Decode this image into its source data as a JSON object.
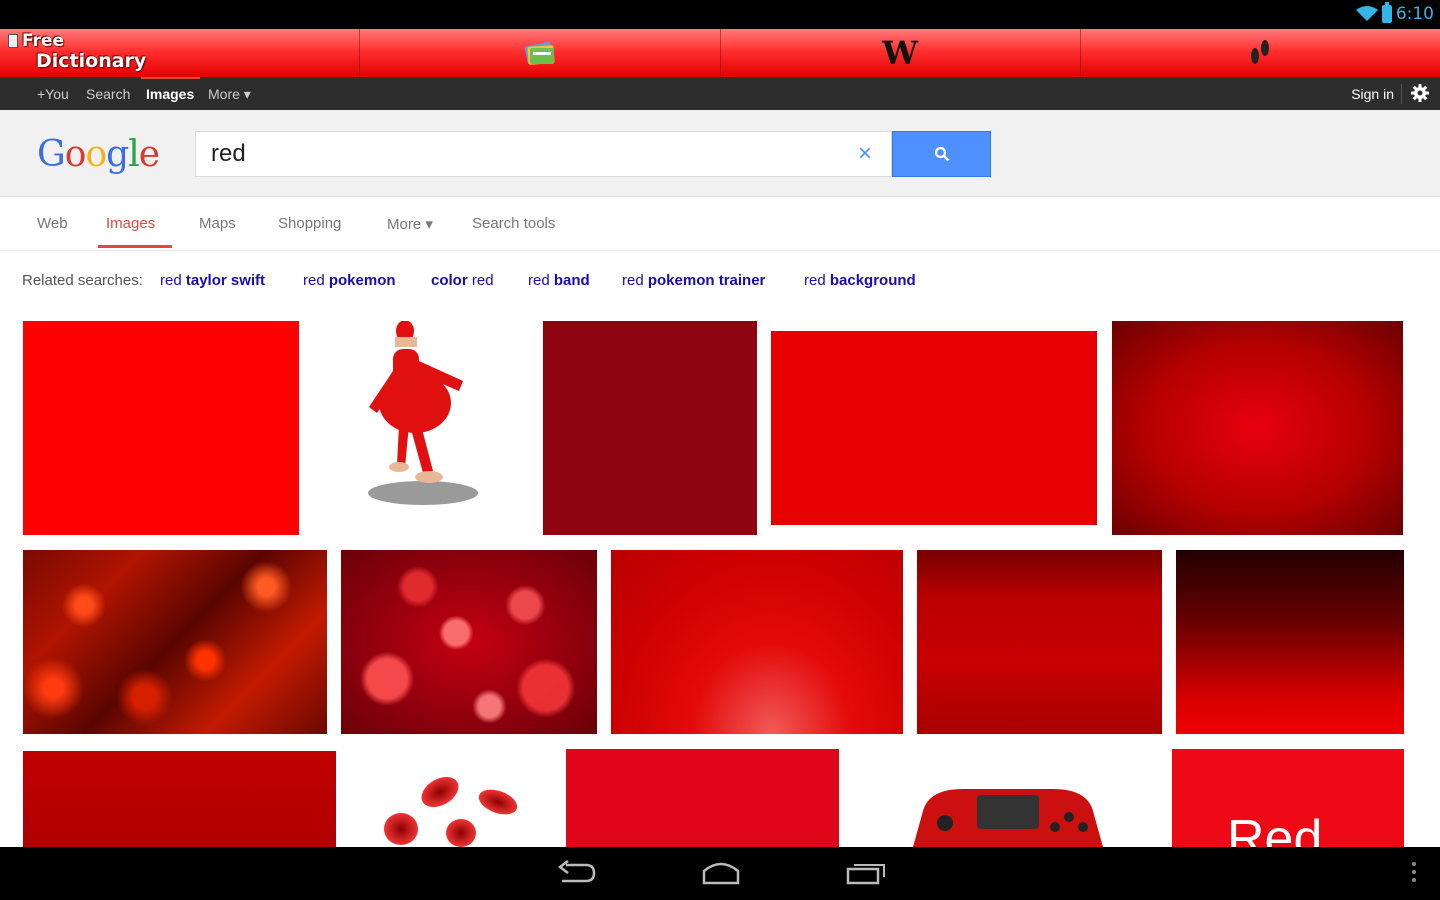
{
  "status_bar": {
    "time": "6:10",
    "accent": "#33b5e5"
  },
  "app_toolbar": {
    "logo_line1": "Free",
    "logo_line2": "Dictionary",
    "wiki_label": "W",
    "slots": [
      "free-dictionary",
      "flashcards",
      "wikipedia",
      "translate"
    ]
  },
  "gbar": {
    "items": [
      "+You",
      "Search",
      "Images",
      "More ▾"
    ],
    "active": "Images",
    "sign_in": "Sign in"
  },
  "search": {
    "logo_letters": [
      {
        "ch": "G",
        "color": "#3b6ee0"
      },
      {
        "ch": "o",
        "color": "#d53b2f"
      },
      {
        "ch": "o",
        "color": "#f0b51f"
      },
      {
        "ch": "g",
        "color": "#3b6ee0"
      },
      {
        "ch": "l",
        "color": "#2aa14a"
      },
      {
        "ch": "e",
        "color": "#d53b2f"
      }
    ],
    "query": "red",
    "clear_label": "×",
    "button_color": "#4d90fe"
  },
  "tabs": {
    "web": "Web",
    "images": "Images",
    "maps": "Maps",
    "shopping": "Shopping",
    "more": "More ▾",
    "tools": "Search tools"
  },
  "related": {
    "label": "Related searches:",
    "items": [
      {
        "prefix": "red ",
        "bold": "taylor swift"
      },
      {
        "prefix": "red ",
        "bold": "pokemon"
      },
      {
        "prefix": "",
        "bold": "color",
        "suffix": " red"
      },
      {
        "prefix": "red ",
        "bold": "band"
      },
      {
        "prefix": "red ",
        "bold": "pokemon trainer"
      },
      {
        "prefix": "red ",
        "bold": "background"
      }
    ]
  },
  "images": {
    "tile_red_text": "Red"
  }
}
